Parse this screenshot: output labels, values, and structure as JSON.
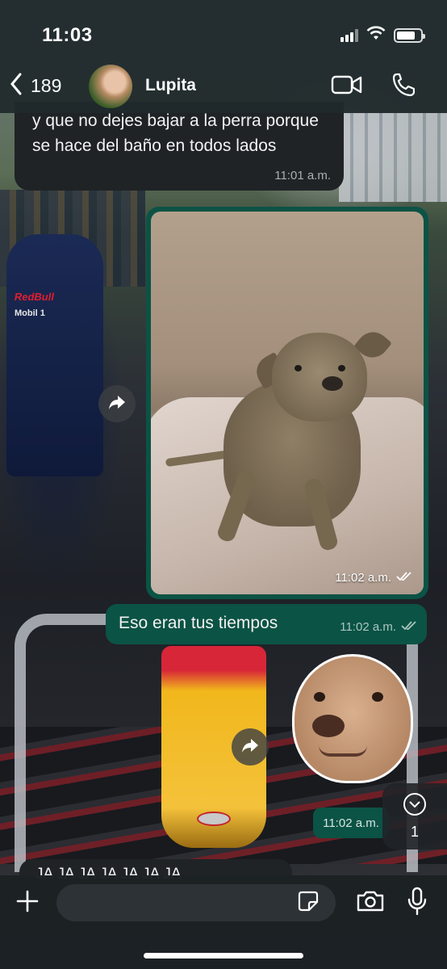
{
  "status_bar": {
    "time": "11:03"
  },
  "header": {
    "back_count": "189",
    "contact_name": "Lupita"
  },
  "messages": [
    {
      "direction": "incoming",
      "text": "y que no dejes bajar a la perra porque se hace del baño en todos lados",
      "time": "11:01 a.m."
    },
    {
      "direction": "outgoing",
      "type": "photo",
      "time": "11:02 a.m.",
      "status": "read"
    },
    {
      "direction": "outgoing",
      "text": "Eso eran tus tiempos",
      "time": "11:02 a.m.",
      "status": "read"
    },
    {
      "direction": "outgoing",
      "type": "sticker",
      "time": "11:02 a.m."
    },
    {
      "direction": "incoming",
      "text": "JA JA JA JA JA JA JA"
    }
  ],
  "unread_pill": {
    "count": "1"
  },
  "wallpaper": {
    "text_redbull": "RedBull",
    "text_mobil": "Mobil 1"
  },
  "colors": {
    "outgoing_bubble": "#0b5345",
    "incoming_bubble": "#1f2326",
    "header_bg": "#20292c"
  },
  "icons": {
    "back": "chevron-left-icon",
    "video": "video-camera-icon",
    "phone": "phone-icon",
    "forward": "forward-arrow-icon",
    "read": "double-check-icon",
    "scroll_down": "chevron-down-icon",
    "plus": "plus-icon",
    "sticker": "sticker-icon",
    "camera": "camera-icon",
    "mic": "microphone-icon"
  }
}
